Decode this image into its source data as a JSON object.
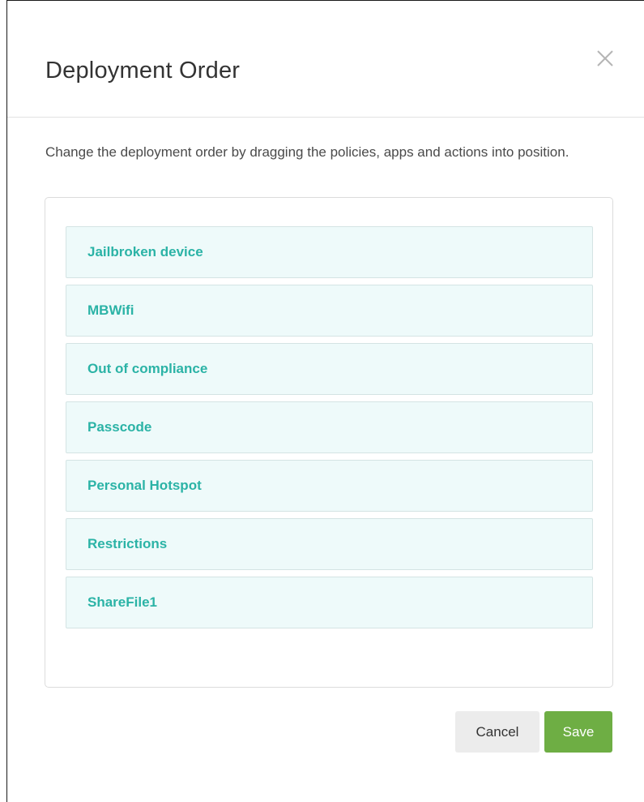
{
  "dialog": {
    "title": "Deployment Order",
    "close_icon": "close-icon",
    "description": "Change the deployment order by dragging the policies, apps and actions into position.",
    "items": [
      {
        "label": "Jailbroken device"
      },
      {
        "label": "MBWifi"
      },
      {
        "label": "Out of compliance"
      },
      {
        "label": "Passcode"
      },
      {
        "label": "Personal Hotspot"
      },
      {
        "label": "Restrictions"
      },
      {
        "label": "ShareFile1"
      }
    ],
    "cancel_label": "Cancel",
    "save_label": "Save"
  },
  "colors": {
    "accent_text": "#2bb3a6",
    "item_background": "#eefafa",
    "save_button": "#6eae44",
    "cancel_button": "#ececec"
  }
}
